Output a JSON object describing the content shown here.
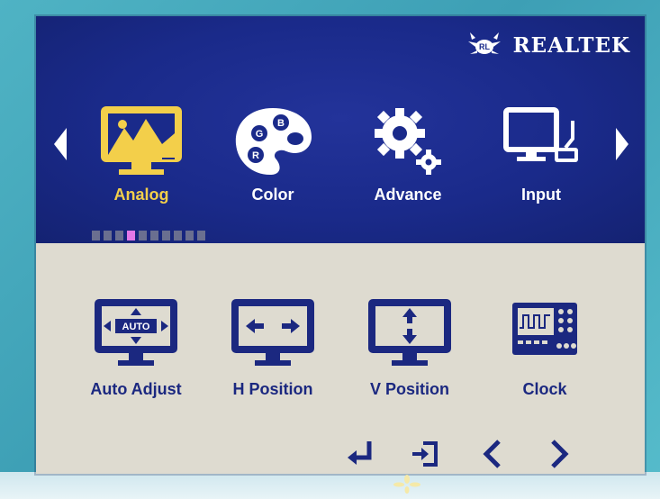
{
  "brand": {
    "name": "REALTEK"
  },
  "tabs": [
    {
      "label": "Analog",
      "icon": "analog-picture-icon",
      "active": true
    },
    {
      "label": "Color",
      "icon": "color-palette-icon",
      "active": false
    },
    {
      "label": "Advance",
      "icon": "gear-icon",
      "active": false
    },
    {
      "label": "Input",
      "icon": "input-monitor-icon",
      "active": false
    }
  ],
  "page_indicator": {
    "total": 10,
    "current": 4
  },
  "items": [
    {
      "label": "Auto Adjust",
      "icon": "auto-adjust-icon",
      "icon_text": "AUTO"
    },
    {
      "label": "H Position",
      "icon": "h-position-icon"
    },
    {
      "label": "V Position",
      "icon": "v-position-icon"
    },
    {
      "label": "Clock",
      "icon": "clock-oscilloscope-icon"
    }
  ],
  "nav": [
    "enter-icon",
    "exit-icon",
    "left-icon",
    "right-icon"
  ],
  "colors": {
    "osd_blue": "#1a2a8a",
    "active_yellow": "#f3cf4a",
    "panel_bg": "#dedbd0"
  }
}
